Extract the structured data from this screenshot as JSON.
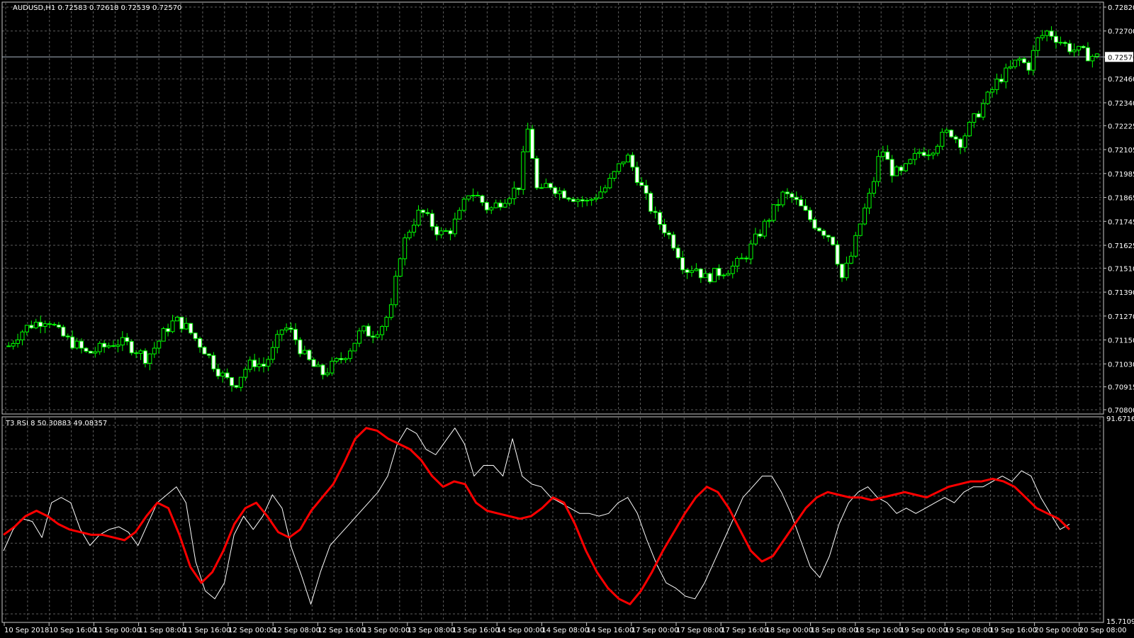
{
  "colors": {
    "background": "#000000",
    "grid": "#5c5c5c",
    "frame": "#c8c8c8",
    "candle_up": "#00ff00",
    "candle_bull_body": "#000000",
    "candle_bear_body": "#ffffff",
    "rsi_line": "#ffffff",
    "t3_line": "#ff0000",
    "text": "#ffffff",
    "price_line": "#a9b4c2"
  },
  "chart_data": [
    {
      "type": "candlestick",
      "title": "AUDUSD,H1  0.72583 0.72618 0.72539 0.72570",
      "price_labels": [
        "0.72820",
        "0.72700",
        "0.72570",
        "0.72460",
        "0.72340",
        "0.72225",
        "0.72105",
        "0.71985",
        "0.71865",
        "0.71745",
        "0.71625",
        "0.71510",
        "0.71390",
        "0.71270",
        "0.71150",
        "0.71030",
        "0.70915",
        "0.70800"
      ],
      "current_price": "0.72570",
      "ylim": [
        0.708,
        0.7282
      ],
      "close_path": [
        0.7112,
        0.7118,
        0.7122,
        0.7124,
        0.7126,
        0.7119,
        0.7115,
        0.7112,
        0.7108,
        0.711,
        0.7112,
        0.7114,
        0.7113,
        0.711,
        0.7106,
        0.7112,
        0.712,
        0.7125,
        0.7122,
        0.7116,
        0.711,
        0.7102,
        0.7096,
        0.7092,
        0.71,
        0.7104,
        0.7102,
        0.711,
        0.7122,
        0.7118,
        0.7108,
        0.7102,
        0.7098,
        0.7102,
        0.7106,
        0.7112,
        0.712,
        0.7118,
        0.7122,
        0.713,
        0.716,
        0.7172,
        0.718,
        0.7174,
        0.7168,
        0.717,
        0.7178,
        0.719,
        0.7186,
        0.718,
        0.7184,
        0.7188,
        0.7192,
        0.7222,
        0.7186,
        0.7194,
        0.719,
        0.7188,
        0.7186,
        0.7184,
        0.7188,
        0.7192,
        0.72,
        0.7208,
        0.7198,
        0.7186,
        0.7176,
        0.717,
        0.7162,
        0.715,
        0.7152,
        0.7146,
        0.7148,
        0.715,
        0.7152,
        0.7156,
        0.7164,
        0.7172,
        0.718,
        0.7188,
        0.7186,
        0.718,
        0.7174,
        0.717,
        0.7166,
        0.7146,
        0.7158,
        0.7176,
        0.719,
        0.7212,
        0.72,
        0.7198,
        0.7204,
        0.721,
        0.721,
        0.7216,
        0.722,
        0.7214,
        0.7222,
        0.723,
        0.7238,
        0.7246,
        0.725,
        0.7256,
        0.7252,
        0.7266,
        0.727,
        0.7266,
        0.7262,
        0.726,
        0.7258,
        0.7257
      ]
    },
    {
      "type": "line",
      "title": "T3 RSI 8 50.30883 49.08357",
      "ylim": [
        15.71093,
        91.67163
      ],
      "ytick_labels": [
        "91.67163",
        "15.71093"
      ],
      "series": [
        {
          "color": "#ffffff",
          "values": [
            42,
            50,
            54,
            53,
            47,
            60,
            62,
            60,
            50,
            44,
            48,
            50,
            51,
            49,
            44,
            52,
            60,
            63,
            66,
            60,
            38,
            27,
            24,
            30,
            48,
            55,
            50,
            55,
            63,
            58,
            43,
            33,
            22,
            34,
            44,
            48,
            52,
            56,
            60,
            64,
            70,
            82,
            88,
            86,
            80,
            78,
            83,
            88,
            82,
            70,
            74,
            74,
            70,
            84,
            70,
            67,
            66,
            62,
            60,
            58,
            56,
            56,
            55,
            56,
            60,
            62,
            56,
            46,
            37,
            30,
            28,
            25,
            24,
            30,
            38,
            46,
            54,
            62,
            66,
            70,
            70,
            64,
            56,
            46,
            36,
            32,
            40,
            52,
            60,
            64,
            66,
            62,
            60,
            56,
            58,
            56,
            58,
            60,
            62,
            60,
            64,
            66,
            66,
            68,
            70,
            68,
            72,
            70,
            62,
            56,
            50,
            52
          ]
        },
        {
          "color": "#ff0000",
          "values": [
            48,
            51,
            55,
            57,
            55,
            52,
            50,
            49,
            48,
            48,
            47,
            46,
            49,
            55,
            60,
            58,
            48,
            36,
            30,
            34,
            42,
            52,
            58,
            60,
            55,
            49,
            47,
            50,
            57,
            62,
            67,
            75,
            84,
            88,
            87,
            84,
            82,
            80,
            76,
            70,
            66,
            68,
            67,
            60,
            57,
            56,
            55,
            54,
            55,
            58,
            62,
            60,
            52,
            42,
            34,
            28,
            24,
            22,
            27,
            34,
            42,
            49,
            56,
            62,
            66,
            64,
            58,
            50,
            42,
            38,
            40,
            46,
            52,
            58,
            62,
            64,
            63,
            62,
            62,
            61,
            62,
            63,
            64,
            63,
            62,
            64,
            66,
            67,
            68,
            68,
            69,
            68,
            66,
            62,
            58,
            56,
            54,
            50
          ]
        }
      ]
    }
  ],
  "time_labels": [
    "10 Sep 2018",
    "10 Sep 16:00",
    "11 Sep 00:00",
    "11 Sep 08:00",
    "11 Sep 16:00",
    "12 Sep 00:00",
    "12 Sep 08:00",
    "12 Sep 16:00",
    "13 Sep 00:00",
    "13 Sep 08:00",
    "13 Sep 16:00",
    "14 Sep 00:00",
    "14 Sep 08:00",
    "14 Sep 16:00",
    "17 Sep 00:00",
    "17 Sep 08:00",
    "17 Sep 16:00",
    "18 Sep 00:00",
    "18 Sep 08:00",
    "18 Sep 16:00",
    "19 Sep 00:00",
    "19 Sep 08:00",
    "19 Sep 16:00",
    "20 Sep 00:00",
    "20 Sep 08:00"
  ]
}
